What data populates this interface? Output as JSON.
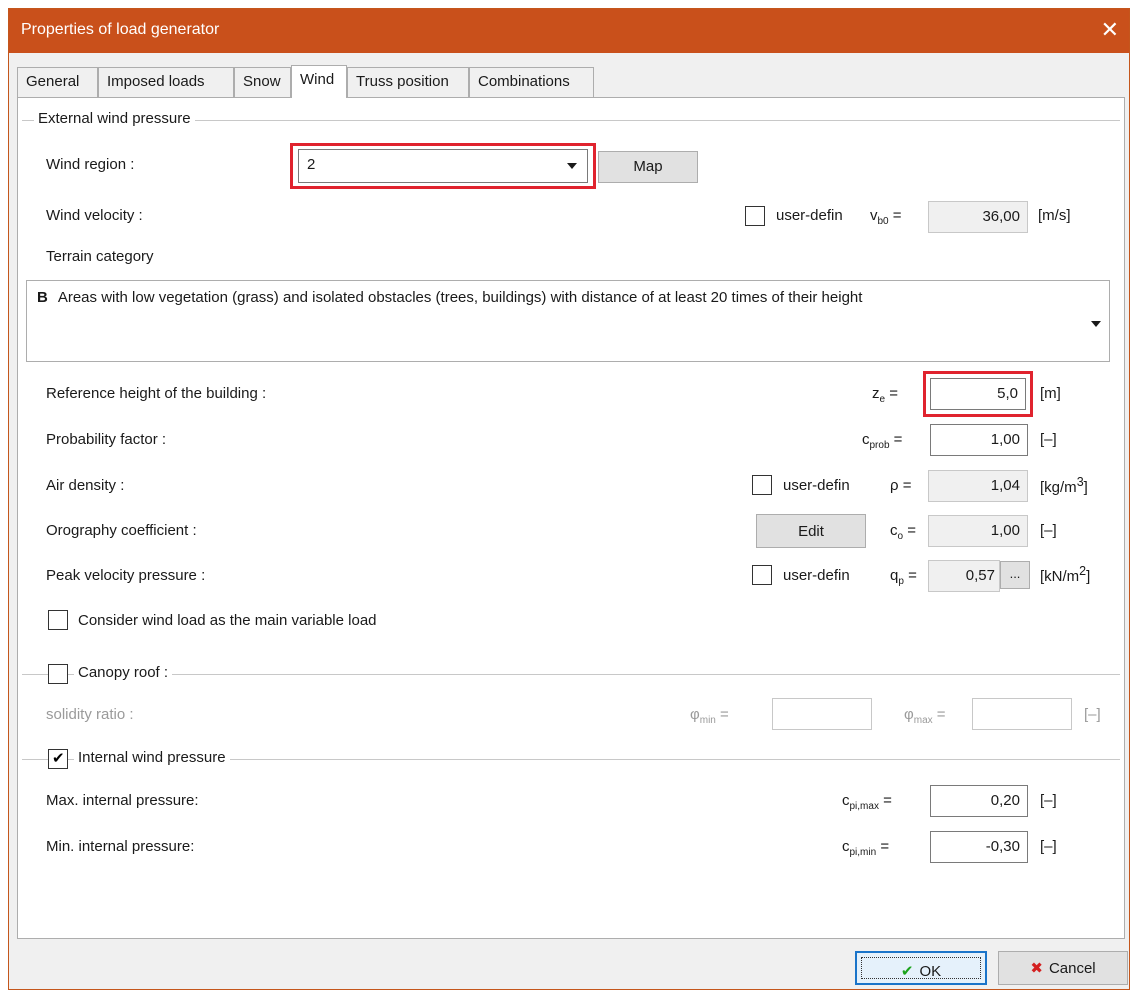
{
  "window": {
    "title": "Properties of load generator",
    "close_glyph": "✕"
  },
  "tabs": [
    {
      "label": "General"
    },
    {
      "label": "Imposed loads"
    },
    {
      "label": "Snow"
    },
    {
      "label": "Wind"
    },
    {
      "label": "Truss position"
    },
    {
      "label": "Combinations"
    }
  ],
  "active_tab": "Wind",
  "external": {
    "group_title": "External wind pressure",
    "wind_region_label": "Wind region :",
    "wind_region_value": "2",
    "map_button": "Map",
    "wind_velocity_label": "Wind velocity :",
    "user_defined": "user-defin",
    "vb0_symbol": "v",
    "vb0_sub": "b0",
    "vb0_value": "36,00",
    "vb0_unit": "[m/s]",
    "terrain_label": "Terrain category",
    "terrain_code": "B",
    "terrain_text": "Areas with low vegetation (grass) and isolated obstacles (trees, buildings) with distance of at least 20 times of their height",
    "ref_height_label": "Reference height of the building :",
    "ze_symbol": "z",
    "ze_sub": "e",
    "ze_value": "5,0",
    "ze_unit": "[m]",
    "prob_label": "Probability factor :",
    "cprob_symbol": "c",
    "cprob_sub": "prob",
    "cprob_value": "1,00",
    "cprob_unit": "[–]",
    "air_label": "Air density :",
    "rho_symbol": "ρ =",
    "rho_value": "1,04",
    "rho_unit": "[kg/m",
    "rho_unit_sup": "3",
    "rho_unit_end": "]",
    "orog_label": "Orography coefficient :",
    "edit_button": "Edit",
    "co_symbol": "c",
    "co_sub": "o",
    "co_value": "1,00",
    "co_unit": "[–]",
    "peak_label": "Peak velocity pressure :",
    "qp_symbol": "q",
    "qp_sub": "p",
    "qp_value": "0,57",
    "qp_button": "...",
    "qp_unit": "[kN/m",
    "qp_unit_sup": "2",
    "qp_unit_end": "]",
    "main_variable_label": "Consider wind load as the main variable load",
    "main_variable_checked": false
  },
  "canopy": {
    "label": "Canopy roof :",
    "checked": false,
    "solidity_label": "solidity ratio :",
    "phimin_symbol": "φ",
    "phimin_sub": "min",
    "phimax_symbol": "φ",
    "phimax_sub": "max",
    "phimin_value": "",
    "phimax_value": "",
    "unit": "[–]"
  },
  "internal": {
    "label": "Internal wind pressure",
    "checked": true,
    "max_label": "Max. internal pressure:",
    "max_symbol": "c",
    "max_sub": "pi,max",
    "max_value": "0,20",
    "max_unit": "[–]",
    "min_label": "Min. internal pressure:",
    "min_symbol": "c",
    "min_sub": "pi,min",
    "min_value": "-0,30",
    "min_unit": "[–]"
  },
  "footer": {
    "ok": "OK",
    "cancel": "Cancel"
  },
  "colors": {
    "titlebar": "#c9501b",
    "highlight": "#e0232e",
    "ok_border": "#1a74c9"
  }
}
